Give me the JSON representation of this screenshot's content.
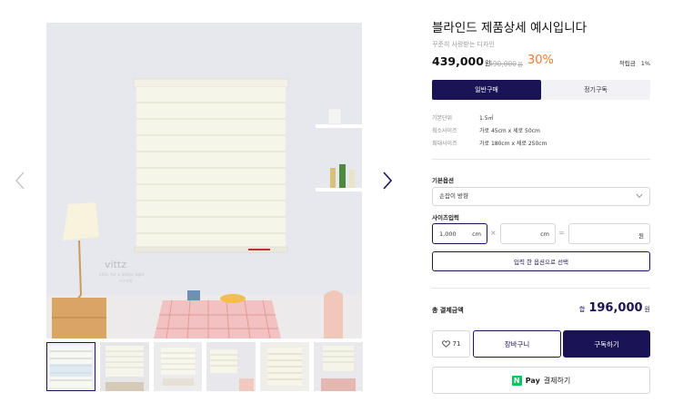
{
  "product": {
    "title": "블라인드 제품상세 예시입니다",
    "subtitle": "꾸준히 사랑받는 디자인",
    "price": "439,000",
    "price_unit": "원",
    "original_price": "490,000",
    "original_unit": "원",
    "discount": "30%",
    "points_label": "적립금",
    "points_value": "1%"
  },
  "tabs": [
    {
      "label": "일반구매",
      "active": true
    },
    {
      "label": "정기구독",
      "active": false
    }
  ],
  "specs": [
    {
      "label": "기본단위",
      "value": "1.5㎡"
    },
    {
      "label": "최소사이즈",
      "value": "가로 45cm x 세로 50cm"
    },
    {
      "label": "최대사이즈",
      "value": "가로 180cm x 세로 250cm"
    }
  ],
  "options": {
    "basic_label": "기본옵션",
    "basic_value": "손잡이 방향",
    "size_label": "사이즈입력",
    "width_value": "1,000",
    "width_unit": "cm",
    "height_value": "",
    "height_unit": "cm",
    "multiply": "×",
    "equals": "=",
    "result_value": "",
    "result_unit": "원",
    "select_button": "입력 한 옵션으로 선택"
  },
  "total": {
    "label": "총 결제금액",
    "prefix": "합",
    "amount": "196,000",
    "suffix": "원"
  },
  "actions": {
    "like_count": "71",
    "cart": "장바구니",
    "subscribe": "구독하기",
    "npay_logo": "N",
    "npay_pay": "Pay",
    "npay_text": "결제하기"
  },
  "image_text": {
    "brand": "vittz",
    "tagline": "vittz, for a better light",
    "sub": "비츠조명"
  },
  "colors": {
    "primary": "#1a1456",
    "discount": "#f07a30",
    "npay": "#03c75a"
  },
  "icons": [
    "chevron-left-icon",
    "chevron-right-icon",
    "chevron-down-icon",
    "heart-icon"
  ]
}
